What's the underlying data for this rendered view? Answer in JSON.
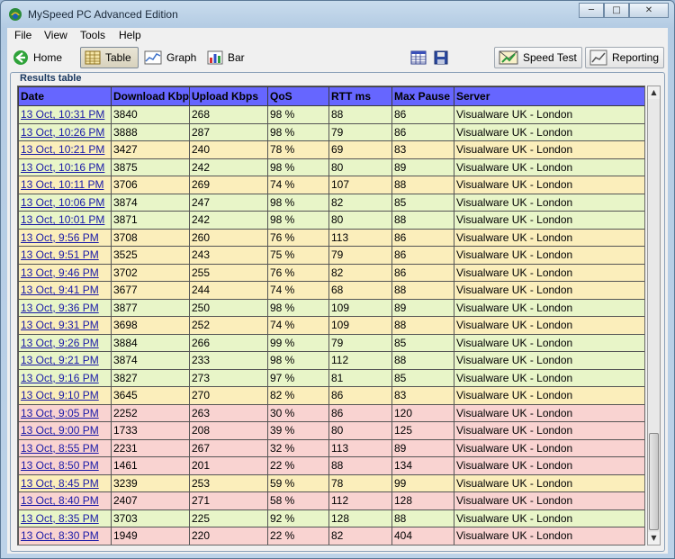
{
  "window": {
    "title": "MySpeed PC Advanced Edition"
  },
  "menu": [
    "File",
    "View",
    "Tools",
    "Help"
  ],
  "toolbar": {
    "home": "Home",
    "table": "Table",
    "graph": "Graph",
    "bar": "Bar",
    "speed_test": "Speed Test",
    "reporting": "Reporting"
  },
  "panel": {
    "title": "Results table"
  },
  "columns": [
    "Date",
    "Download Kbps",
    "Upload Kbps",
    "QoS",
    "RTT ms",
    "Max Pause",
    "Server"
  ],
  "rows": [
    {
      "date": "13 Oct, 10:31 PM",
      "down": "3840",
      "up": "268",
      "qos": "98 %",
      "rtt": "88",
      "pause": "86",
      "server": "Visualware UK - London",
      "status": "good"
    },
    {
      "date": "13 Oct, 10:26 PM",
      "down": "3888",
      "up": "287",
      "qos": "98 %",
      "rtt": "79",
      "pause": "86",
      "server": "Visualware UK - London",
      "status": "good"
    },
    {
      "date": "13 Oct, 10:21 PM",
      "down": "3427",
      "up": "240",
      "qos": "78 %",
      "rtt": "69",
      "pause": "83",
      "server": "Visualware UK - London",
      "status": "fair"
    },
    {
      "date": "13 Oct, 10:16 PM",
      "down": "3875",
      "up": "242",
      "qos": "98 %",
      "rtt": "80",
      "pause": "89",
      "server": "Visualware UK - London",
      "status": "good"
    },
    {
      "date": "13 Oct, 10:11 PM",
      "down": "3706",
      "up": "269",
      "qos": "74 %",
      "rtt": "107",
      "pause": "88",
      "server": "Visualware UK - London",
      "status": "fair"
    },
    {
      "date": "13 Oct, 10:06 PM",
      "down": "3874",
      "up": "247",
      "qos": "98 %",
      "rtt": "82",
      "pause": "85",
      "server": "Visualware UK - London",
      "status": "good"
    },
    {
      "date": "13 Oct, 10:01 PM",
      "down": "3871",
      "up": "242",
      "qos": "98 %",
      "rtt": "80",
      "pause": "88",
      "server": "Visualware UK - London",
      "status": "good"
    },
    {
      "date": "13 Oct, 9:56 PM",
      "down": "3708",
      "up": "260",
      "qos": "76 %",
      "rtt": "113",
      "pause": "86",
      "server": "Visualware UK - London",
      "status": "fair"
    },
    {
      "date": "13 Oct, 9:51 PM",
      "down": "3525",
      "up": "243",
      "qos": "75 %",
      "rtt": "79",
      "pause": "86",
      "server": "Visualware UK - London",
      "status": "fair"
    },
    {
      "date": "13 Oct, 9:46 PM",
      "down": "3702",
      "up": "255",
      "qos": "76 %",
      "rtt": "82",
      "pause": "86",
      "server": "Visualware UK - London",
      "status": "fair"
    },
    {
      "date": "13 Oct, 9:41 PM",
      "down": "3677",
      "up": "244",
      "qos": "74 %",
      "rtt": "68",
      "pause": "88",
      "server": "Visualware UK - London",
      "status": "fair"
    },
    {
      "date": "13 Oct, 9:36 PM",
      "down": "3877",
      "up": "250",
      "qos": "98 %",
      "rtt": "109",
      "pause": "89",
      "server": "Visualware UK - London",
      "status": "good"
    },
    {
      "date": "13 Oct, 9:31 PM",
      "down": "3698",
      "up": "252",
      "qos": "74 %",
      "rtt": "109",
      "pause": "88",
      "server": "Visualware UK - London",
      "status": "fair"
    },
    {
      "date": "13 Oct, 9:26 PM",
      "down": "3884",
      "up": "266",
      "qos": "99 %",
      "rtt": "79",
      "pause": "85",
      "server": "Visualware UK - London",
      "status": "good"
    },
    {
      "date": "13 Oct, 9:21 PM",
      "down": "3874",
      "up": "233",
      "qos": "98 %",
      "rtt": "112",
      "pause": "88",
      "server": "Visualware UK - London",
      "status": "good"
    },
    {
      "date": "13 Oct, 9:16 PM",
      "down": "3827",
      "up": "273",
      "qos": "97 %",
      "rtt": "81",
      "pause": "85",
      "server": "Visualware UK - London",
      "status": "good"
    },
    {
      "date": "13 Oct, 9:10 PM",
      "down": "3645",
      "up": "270",
      "qos": "82 %",
      "rtt": "86",
      "pause": "83",
      "server": "Visualware UK - London",
      "status": "fair"
    },
    {
      "date": "13 Oct, 9:05 PM",
      "down": "2252",
      "up": "263",
      "qos": "30 %",
      "rtt": "86",
      "pause": "120",
      "server": "Visualware UK - London",
      "status": "poor"
    },
    {
      "date": "13 Oct, 9:00 PM",
      "down": "1733",
      "up": "208",
      "qos": "39 %",
      "rtt": "80",
      "pause": "125",
      "server": "Visualware UK - London",
      "status": "poor"
    },
    {
      "date": "13 Oct, 8:55 PM",
      "down": "2231",
      "up": "267",
      "qos": "32 %",
      "rtt": "113",
      "pause": "89",
      "server": "Visualware UK - London",
      "status": "poor"
    },
    {
      "date": "13 Oct, 8:50 PM",
      "down": "1461",
      "up": "201",
      "qos": "22 %",
      "rtt": "88",
      "pause": "134",
      "server": "Visualware UK - London",
      "status": "poor"
    },
    {
      "date": "13 Oct, 8:45 PM",
      "down": "3239",
      "up": "253",
      "qos": "59 %",
      "rtt": "78",
      "pause": "99",
      "server": "Visualware UK - London",
      "status": "fair"
    },
    {
      "date": "13 Oct, 8:40 PM",
      "down": "2407",
      "up": "271",
      "qos": "58 %",
      "rtt": "112",
      "pause": "128",
      "server": "Visualware UK - London",
      "status": "poor"
    },
    {
      "date": "13 Oct, 8:35 PM",
      "down": "3703",
      "up": "225",
      "qos": "92 %",
      "rtt": "128",
      "pause": "88",
      "server": "Visualware UK - London",
      "status": "good"
    },
    {
      "date": "13 Oct, 8:30 PM",
      "down": "1949",
      "up": "220",
      "qos": "22 %",
      "rtt": "82",
      "pause": "404",
      "server": "Visualware UK - London",
      "status": "poor"
    }
  ],
  "colors": {
    "header": "#6666ff",
    "good": "#e8f5c8",
    "fair": "#fbeebb",
    "poor": "#f9d3d1"
  }
}
